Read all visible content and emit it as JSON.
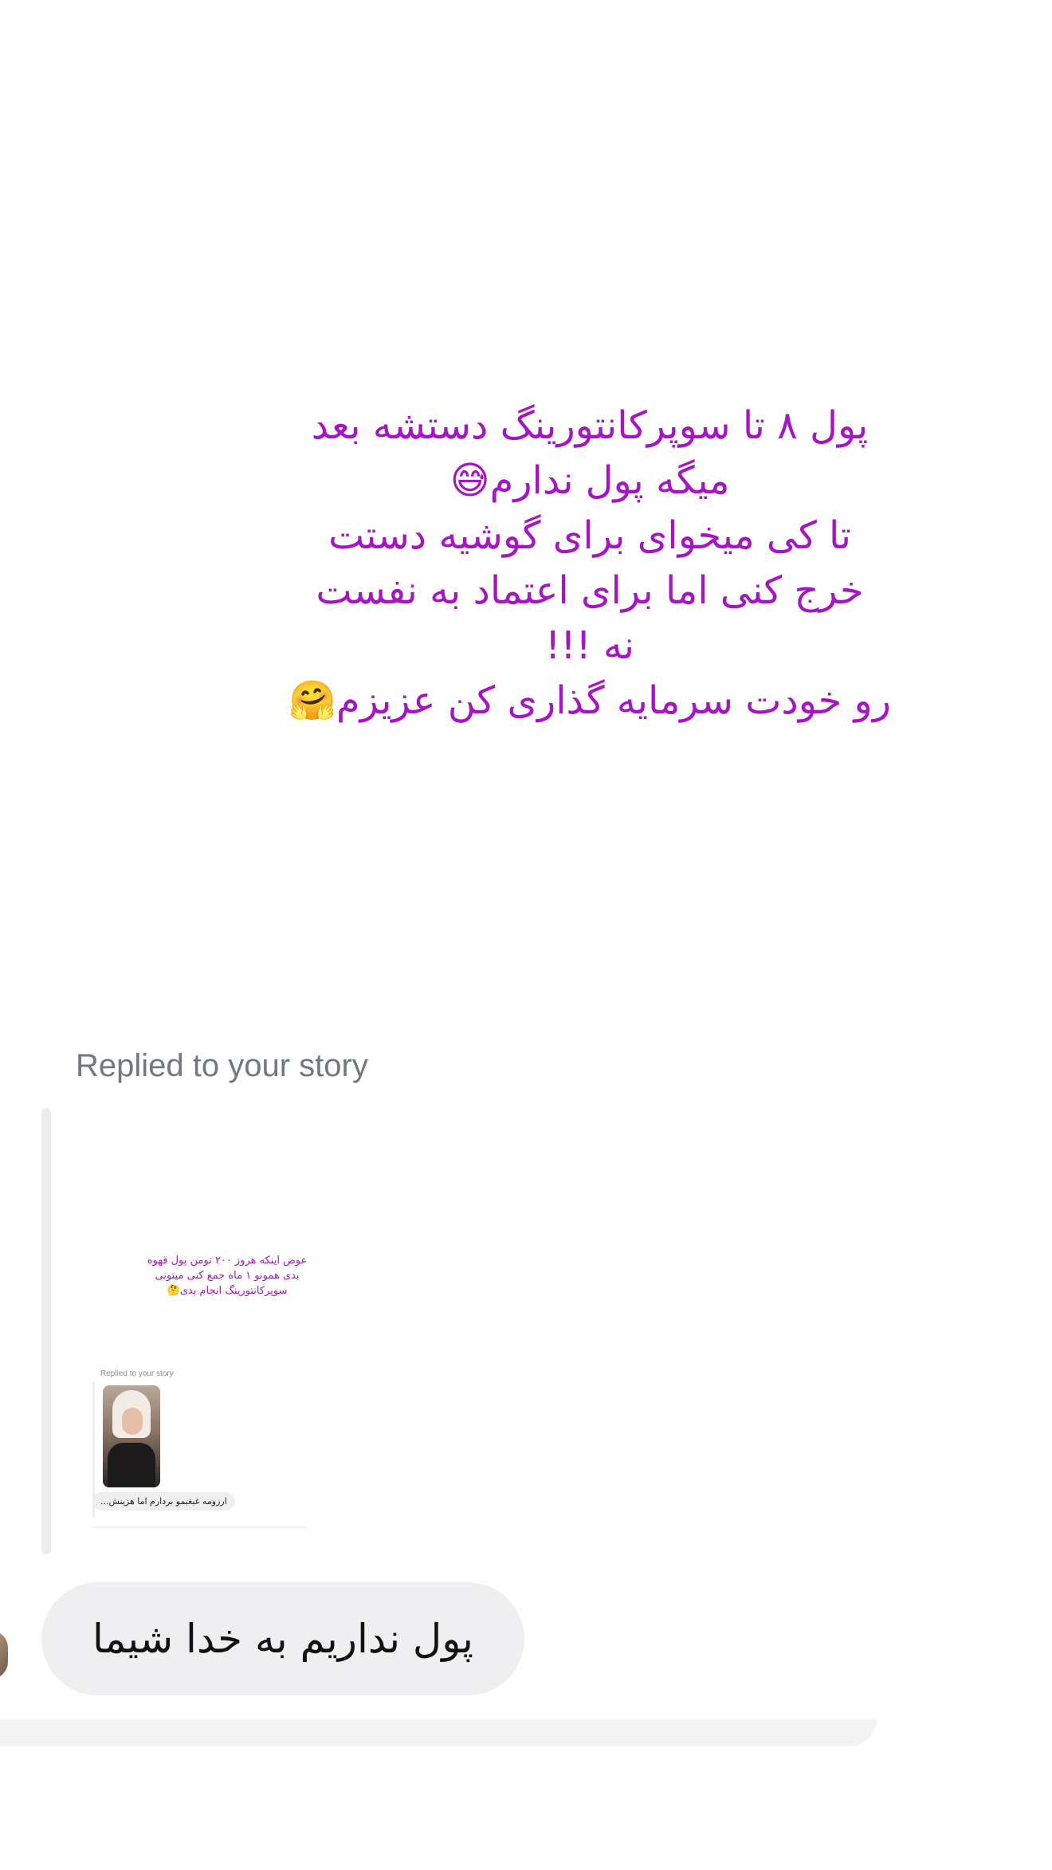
{
  "story": {
    "lines": [
      "پول ۸ تا سوپرکانتورینگ دستشه بعد",
      "میگه پول ندارم😅",
      "تا کی میخوای برای گوشیه دستت",
      "خرج کنی اما برای اعتماد به نفست",
      "نه !!!",
      "رو خودت سرمایه گذاری کن عزیزم🤗"
    ],
    "text_color": "#a515c4"
  },
  "reply": {
    "label": "Replied to your story",
    "preview": {
      "story_lines": [
        "عوض اینکه هروز ۲۰۰ تومن پول قهوه",
        "بدی همونو ۱ ماه جمع کنی میتونی",
        "سوپرکانتورینگ انجام بدی🤔"
      ],
      "replied_label": "Replied to your story",
      "bubble_text": "ارزومه غبغبمو بردارم اما هزینش..."
    }
  },
  "message": {
    "text": "پول نداریم به خدا شیما"
  },
  "colors": {
    "bubble_bg": "#efeff1",
    "label_gray": "#737880",
    "reply_bar": "#ededef"
  }
}
